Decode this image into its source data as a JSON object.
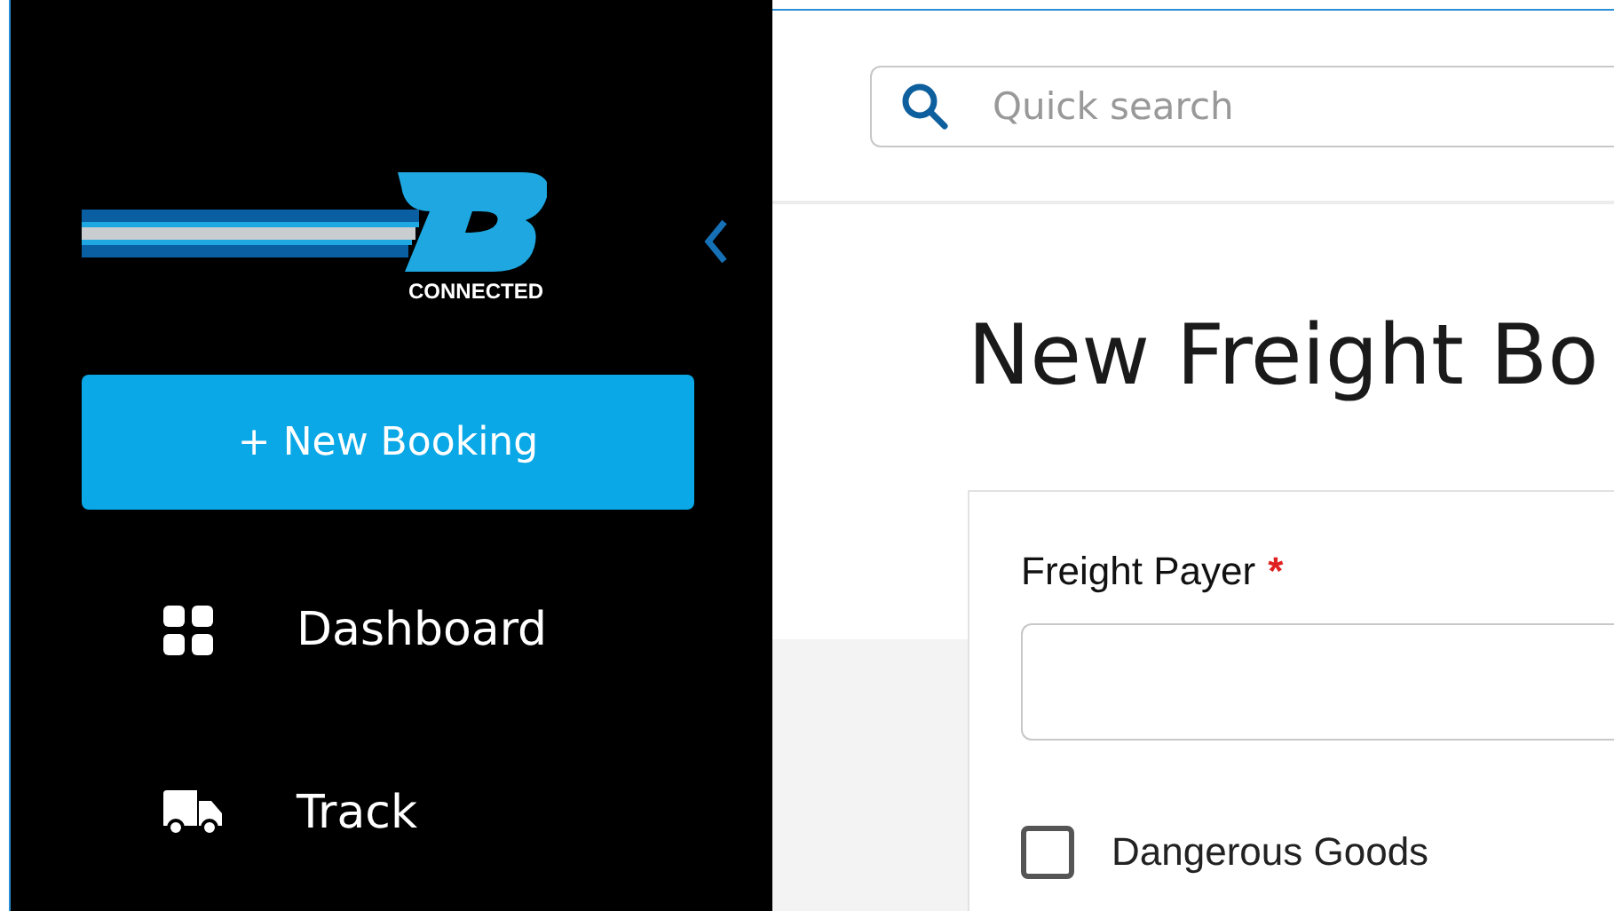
{
  "sidebar": {
    "logo": {
      "caption": "CONNECTED"
    },
    "new_booking_button": "+ New Booking",
    "nav_items": [
      {
        "label": "Dashboard",
        "kind": "grid"
      },
      {
        "label": "Track",
        "kind": "truck"
      }
    ]
  },
  "header": {
    "search": {
      "placeholder": "Quick search"
    }
  },
  "page": {
    "title": "New Freight Bo",
    "form": [
      {
        "kind": "text",
        "label": "Freight Payer",
        "required_mark": "*"
      },
      {
        "kind": "checkbox",
        "label": "Dangerous Goods",
        "checked": false
      }
    ]
  }
}
